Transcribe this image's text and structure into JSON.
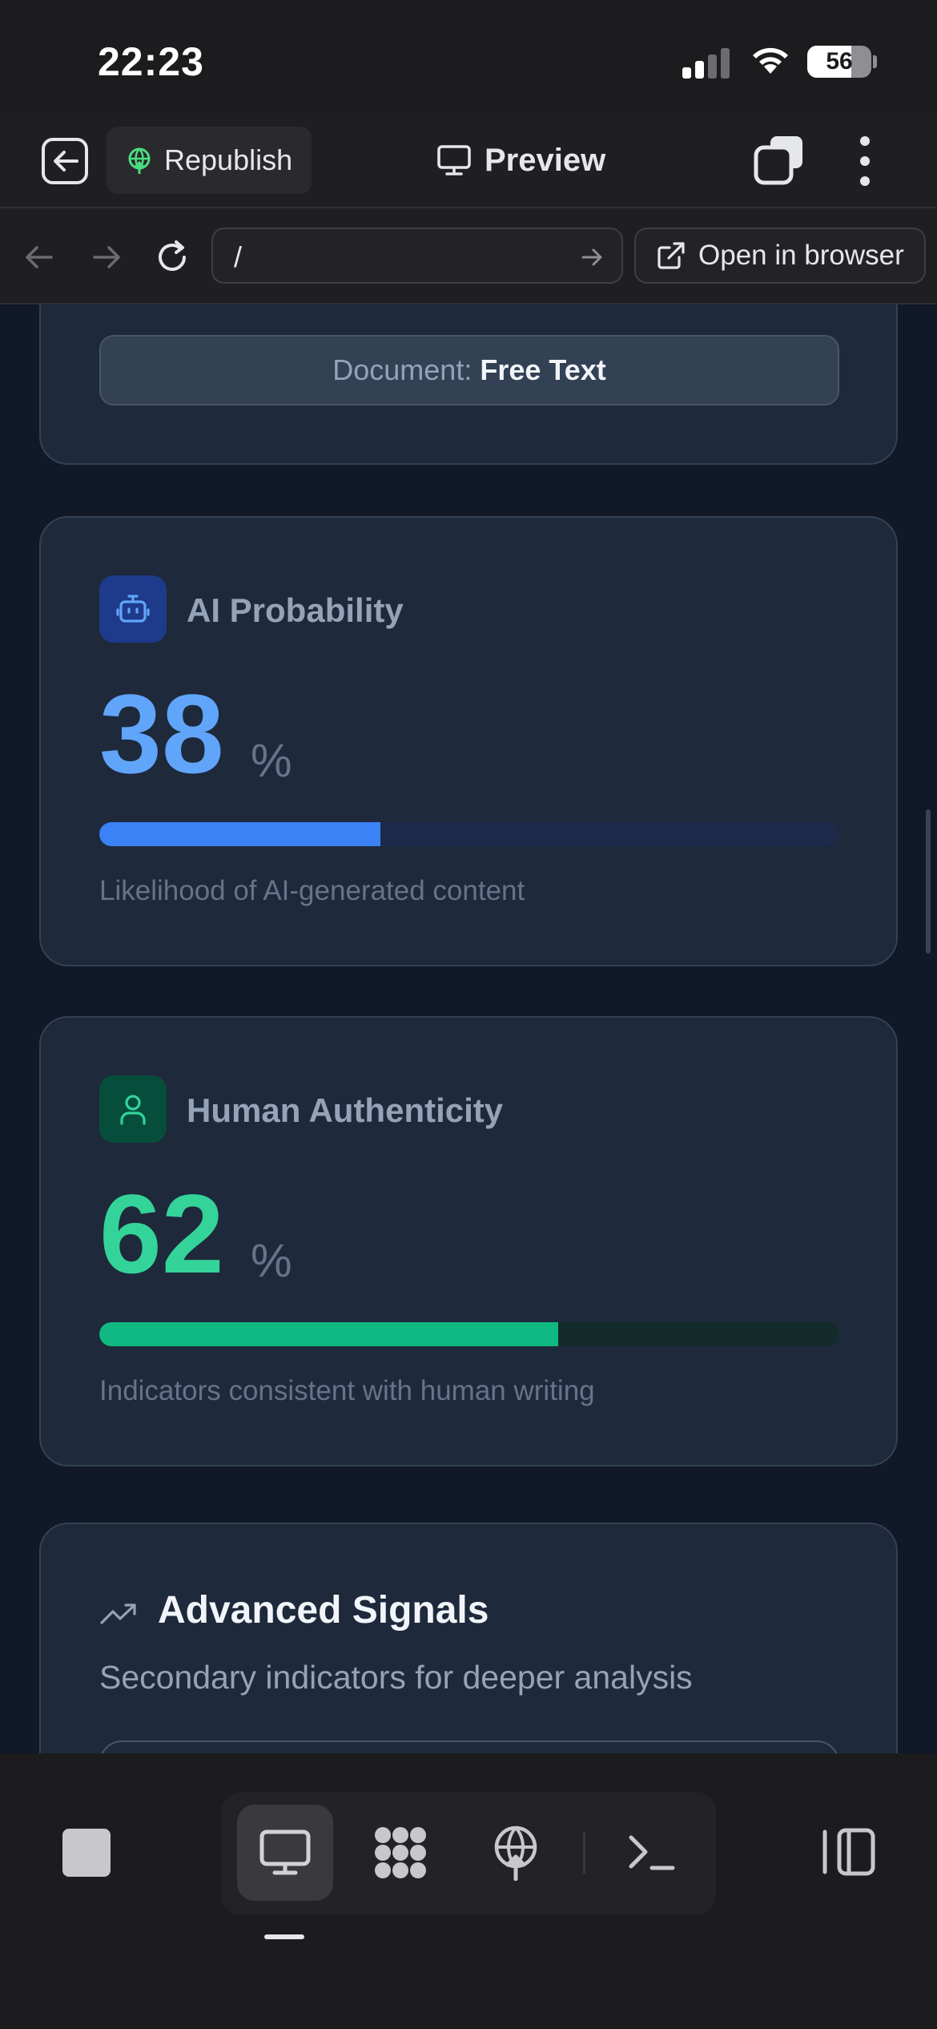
{
  "status_bar": {
    "time": "22:23",
    "battery": "56"
  },
  "toolbar": {
    "republish_label": "Republish",
    "preview_label": "Preview"
  },
  "navbar": {
    "url": "/",
    "open_in_browser_label": "Open in browser"
  },
  "document_card": {
    "label": "Document:",
    "value": "Free Text"
  },
  "metrics": [
    {
      "title": "AI Probability",
      "value": "38",
      "unit": "%",
      "progress_fraction": 0.38,
      "description": "Likelihood of AI-generated content",
      "accent_color": "#60a5fa",
      "bar_color": "#3b82f6",
      "track_color": "#1e2a4a",
      "icon_bg": "#1e3a8a",
      "icon": "robot-icon"
    },
    {
      "title": "Human Authenticity",
      "value": "62",
      "unit": "%",
      "progress_fraction": 0.62,
      "description": "Indicators consistent with human writing",
      "accent_color": "#34d399",
      "bar_color": "#10b981",
      "track_color": "#142b2c",
      "icon_bg": "#064e3b",
      "icon": "user-icon"
    }
  ],
  "advanced_signals": {
    "title": "Advanced Signals",
    "subtitle": "Secondary indicators for deeper analysis"
  },
  "bottom_dock": {
    "active_item": "preview-tab"
  }
}
